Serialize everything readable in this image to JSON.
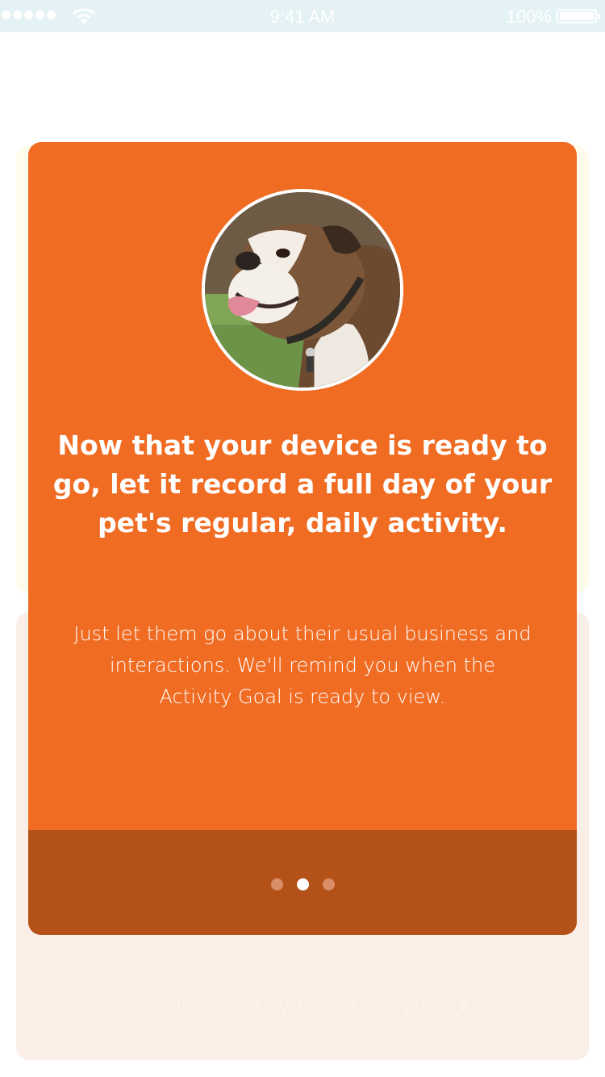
{
  "status_bar": {
    "time": "9:41 AM",
    "battery_percent": "100%",
    "signal_bars": 5,
    "wifi_icon": "wifi-icon",
    "battery_icon": "battery-icon"
  },
  "onboarding_card": {
    "avatar_icon": "dog-photo",
    "headline": "Now that your device is ready to go, let it record a full day of your pet's regular, daily activity.",
    "body": "Just let them go about their usual business and interactions. We'll remind you when the Activity Goal is ready to view.",
    "page_count": 3,
    "current_page": 2
  },
  "proceed_link": {
    "label": "or Proceed Without Device",
    "icon": "chevron-right-icon"
  },
  "colors": {
    "card": "#f06c23",
    "card_footer": "#b45119",
    "status_bar": "#e4f2f5",
    "back_card_yellow": "#fffcec",
    "back_card_peach": "#fbeee6"
  }
}
